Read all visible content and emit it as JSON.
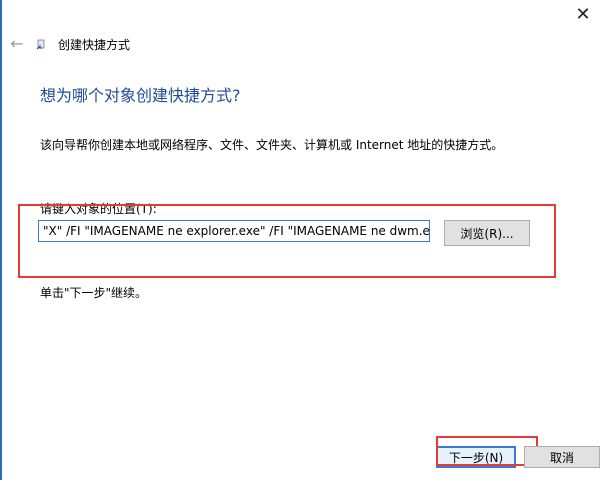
{
  "window": {
    "title": "创建快捷方式",
    "close_glyph": "✕",
    "back_glyph": "←"
  },
  "page": {
    "heading": "想为哪个对象创建快捷方式?",
    "description": "该向导帮你创建本地或网络程序、文件、文件夹、计算机或 Internet 地址的快捷方式。",
    "field_label": "请键入对象的位置(T):",
    "location_value": "\"X\" /FI \"IMAGENAME ne explorer.exe\" /FI \"IMAGENAME ne dwm.exe\"",
    "browse_label": "浏览(R)...",
    "hint": "单击\"下一步\"继续。"
  },
  "footer": {
    "next_label": "下一步(N)",
    "cancel_label": "取消"
  },
  "colors": {
    "heading": "#1e4c9a",
    "highlight": "#e53935",
    "focus": "#3b78d8"
  },
  "icons": {
    "close": "close-icon",
    "back": "back-arrow-icon",
    "title": "shortcut-icon"
  }
}
